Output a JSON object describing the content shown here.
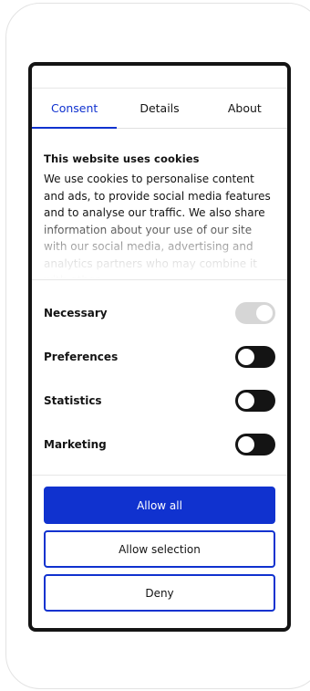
{
  "tabs": [
    {
      "label": "Consent",
      "active": true
    },
    {
      "label": "Details",
      "active": false
    },
    {
      "label": "About",
      "active": false
    }
  ],
  "content": {
    "title": "This website uses cookies",
    "body": "We use cookies to personalise content and ads, to provide social media features and to analyse our traffic. We also share information about your use of our site with our social media, advertising and analytics partners who may combine it with other"
  },
  "toggles": [
    {
      "label": "Necessary",
      "state": "on",
      "disabled": true
    },
    {
      "label": "Preferences",
      "state": "off",
      "disabled": false
    },
    {
      "label": "Statistics",
      "state": "off",
      "disabled": false
    },
    {
      "label": "Marketing",
      "state": "off",
      "disabled": false
    }
  ],
  "buttons": {
    "allow_all": "Allow all",
    "allow_selection": "Allow selection",
    "deny": "Deny"
  },
  "colors": {
    "accent": "#1032cf",
    "toggle_off": "#141414",
    "toggle_disabled": "#d6d6d6"
  }
}
